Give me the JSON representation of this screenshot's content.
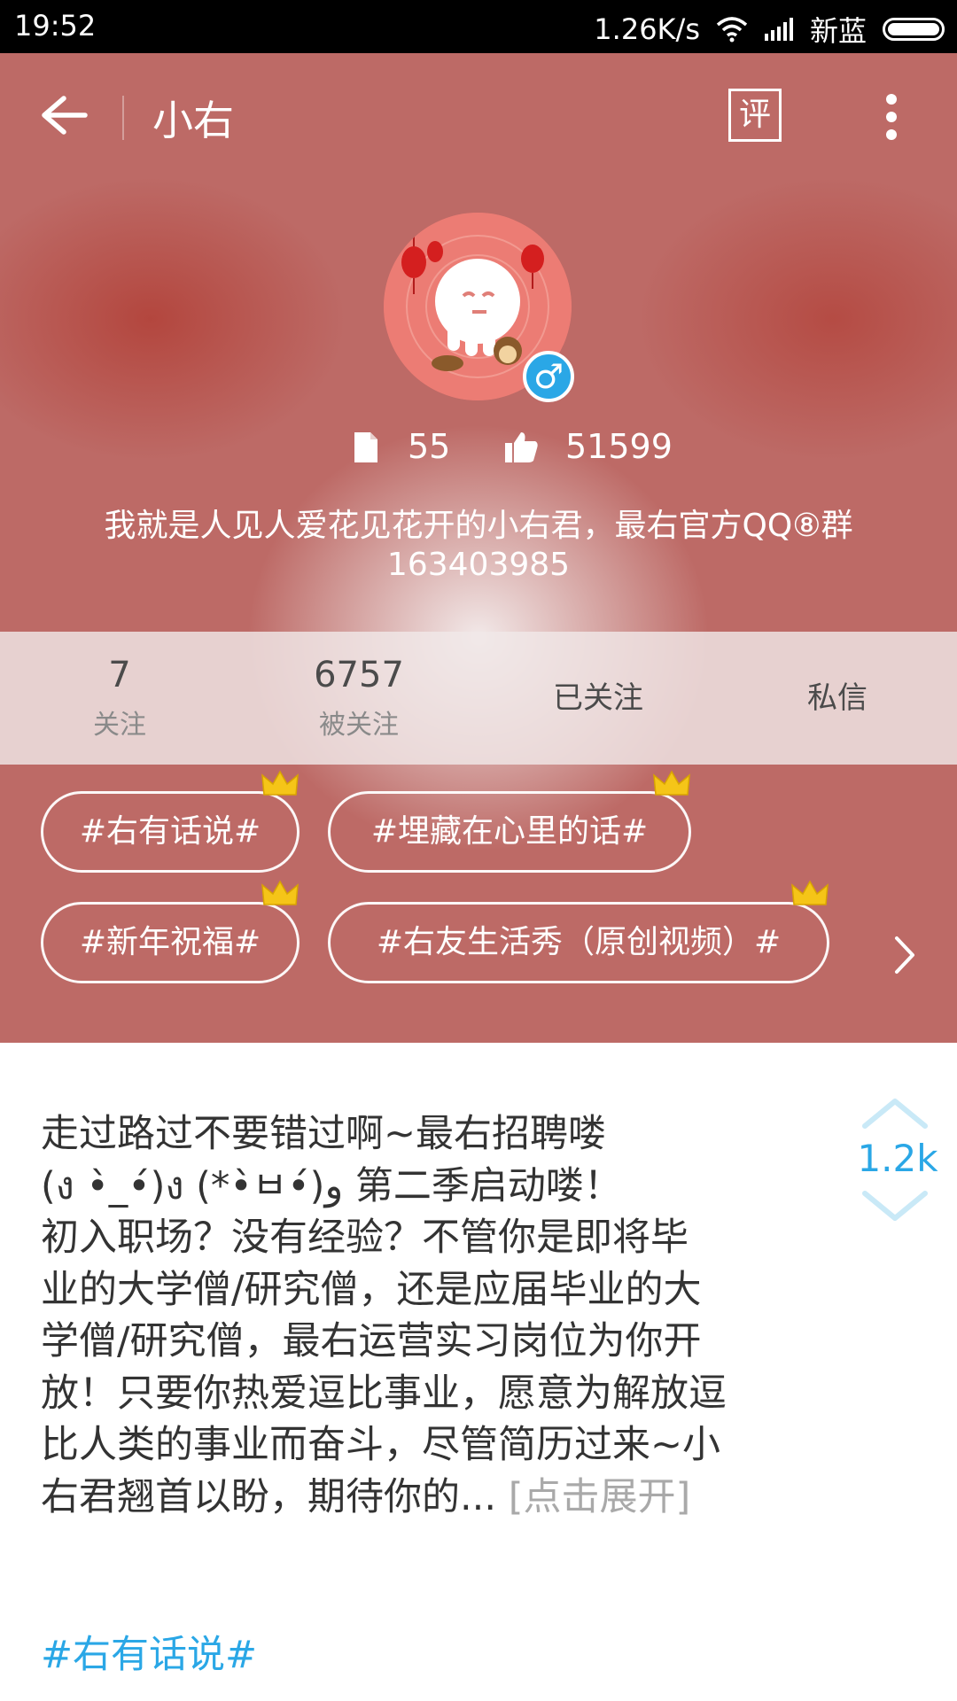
{
  "status_bar": {
    "time": "19:52",
    "speed": "1.26K/s",
    "carrier": "新蓝"
  },
  "header": {
    "title": "小右",
    "comment_label": "评"
  },
  "profile": {
    "posts_count": "55",
    "likes_count": "51599",
    "bio_line1": "我就是人见人爱花见花开的小右君，最右官方QQ⑧群",
    "bio_line2": "163403985",
    "gender": "male"
  },
  "follow_strip": {
    "following_count": "7",
    "following_label": "关注",
    "followers_count": "6757",
    "followers_label": "被关注",
    "followed_button": "已关注",
    "message_button": "私信"
  },
  "tags": [
    {
      "label": "#右有话说#"
    },
    {
      "label": "#埋藏在心里的话#"
    },
    {
      "label": "#新年祝福#"
    },
    {
      "label": "#右友生活秀（原创视频）#"
    }
  ],
  "post": {
    "line1": "走过路过不要错过啊~最右招聘喽",
    "line2": "(ง •̀_•́)ง (*•̀ㅂ•́)و 第二季启动喽！",
    "line3": "初入职场？没有经验？不管你是即将毕",
    "line4": "业的大学僧/研究僧，还是应届毕业的大",
    "line5": "学僧/研究僧，最右运营实习岗位为你开",
    "line6": "放！只要你热爱逗比事业，愿意为解放逗",
    "line7": "比人类的事业而奋斗，尽管简历过来~小",
    "line8": "右君翘首以盼，期待你的...",
    "expand": "[点击展开]",
    "tag": "#右有话说#",
    "votes": "1.2k"
  },
  "colors": {
    "header_bg": "#bd6a66",
    "accent_blue": "#2aa7e6"
  }
}
